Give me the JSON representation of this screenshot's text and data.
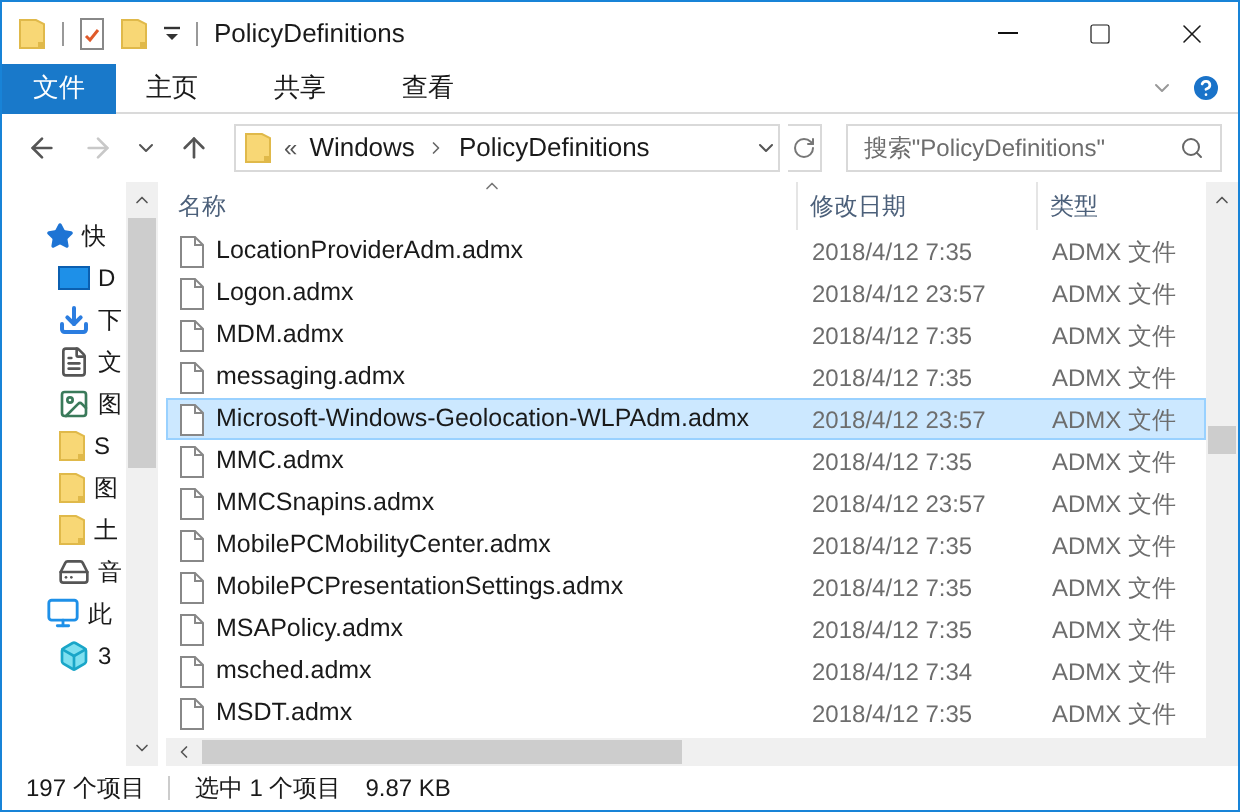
{
  "window": {
    "title": "PolicyDefinitions"
  },
  "ribbon_tabs": [
    {
      "label": "文件",
      "kind": "file"
    },
    {
      "label": "主页",
      "kind": "tab"
    },
    {
      "label": "共享",
      "kind": "tab"
    },
    {
      "label": "查看",
      "kind": "tab"
    }
  ],
  "navigation": [
    {
      "kind": "back",
      "disabled": false
    },
    {
      "kind": "forward",
      "disabled": true
    },
    {
      "kind": "recent",
      "disabled": false
    },
    {
      "kind": "up",
      "disabled": false
    }
  ],
  "address": {
    "overflow": "«",
    "crumbs": [
      "Windows",
      "PolicyDefinitions"
    ]
  },
  "search": {
    "placeholder": "搜索\"PolicyDefinitions\""
  },
  "sidebar": {
    "items": [
      {
        "label": "快",
        "kind": "star"
      },
      {
        "label": "D",
        "kind": "desktop"
      },
      {
        "label": "下",
        "kind": "download"
      },
      {
        "label": "文",
        "kind": "document"
      },
      {
        "label": "图",
        "kind": "image"
      },
      {
        "label": "S",
        "kind": "folder"
      },
      {
        "label": "图",
        "kind": "folder"
      },
      {
        "label": "土",
        "kind": "folder"
      },
      {
        "label": "音",
        "kind": "drive"
      },
      {
        "label": "此",
        "kind": "pc"
      },
      {
        "label": "3",
        "kind": "cube"
      }
    ]
  },
  "table": {
    "columns": [
      {
        "label": "名称",
        "sorted": true
      },
      {
        "label": "修改日期",
        "sorted": false
      },
      {
        "label": "类型",
        "sorted": false
      }
    ],
    "rows": [
      {
        "name": "LocationProviderAdm.admx",
        "date": "2018/4/12 7:35",
        "type": "ADMX 文件",
        "selected": false
      },
      {
        "name": "Logon.admx",
        "date": "2018/4/12 23:57",
        "type": "ADMX 文件",
        "selected": false
      },
      {
        "name": "MDM.admx",
        "date": "2018/4/12 7:35",
        "type": "ADMX 文件",
        "selected": false
      },
      {
        "name": "messaging.admx",
        "date": "2018/4/12 7:35",
        "type": "ADMX 文件",
        "selected": false
      },
      {
        "name": "Microsoft-Windows-Geolocation-WLPAdm.admx",
        "date": "2018/4/12 23:57",
        "type": "ADMX 文件",
        "selected": true
      },
      {
        "name": "MMC.admx",
        "date": "2018/4/12 7:35",
        "type": "ADMX 文件",
        "selected": false
      },
      {
        "name": "MMCSnapins.admx",
        "date": "2018/4/12 23:57",
        "type": "ADMX 文件",
        "selected": false
      },
      {
        "name": "MobilePCMobilityCenter.admx",
        "date": "2018/4/12 7:35",
        "type": "ADMX 文件",
        "selected": false
      },
      {
        "name": "MobilePCPresentationSettings.admx",
        "date": "2018/4/12 7:35",
        "type": "ADMX 文件",
        "selected": false
      },
      {
        "name": "MSAPolicy.admx",
        "date": "2018/4/12 7:35",
        "type": "ADMX 文件",
        "selected": false
      },
      {
        "name": "msched.admx",
        "date": "2018/4/12 7:34",
        "type": "ADMX 文件",
        "selected": false
      },
      {
        "name": "MSDT.admx",
        "date": "2018/4/12 7:35",
        "type": "ADMX 文件",
        "selected": false
      }
    ]
  },
  "status_bar": {
    "count": "197 个项目",
    "selection": "选中 1 个项目",
    "size": "9.87 KB"
  }
}
